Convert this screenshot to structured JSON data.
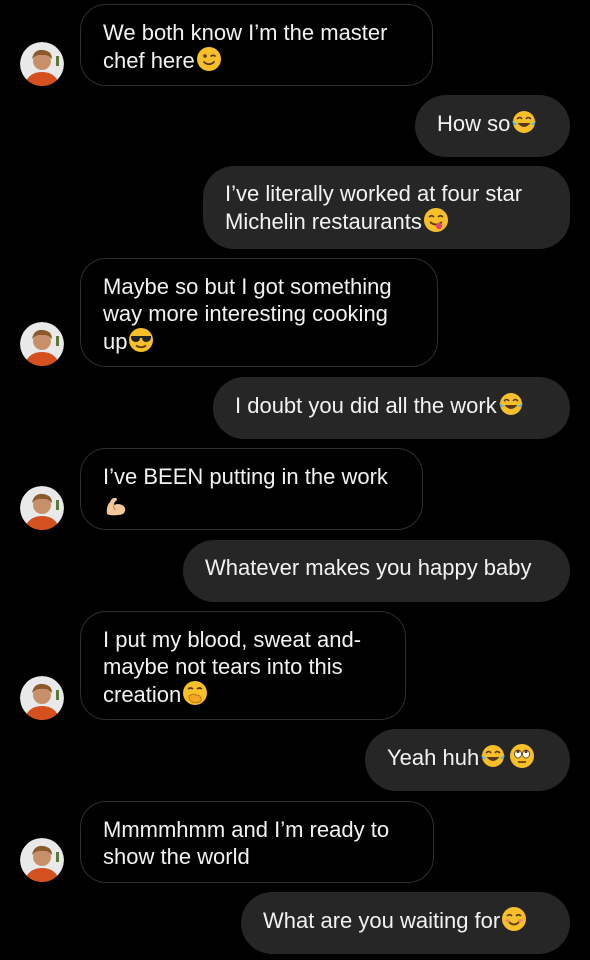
{
  "conversation": {
    "messages": [
      {
        "side": "in",
        "text": "We both know I’m the master chef here",
        "emoji": [
          "winking-face"
        ]
      },
      {
        "side": "out",
        "text": "How so",
        "emoji": [
          "tears-of-joy"
        ]
      },
      {
        "side": "out",
        "text": "I’ve literally worked at four star Michelin restaurants",
        "emoji": [
          "yum-face"
        ]
      },
      {
        "side": "in",
        "text": "Maybe so but I got something way more interesting cooking up",
        "emoji": [
          "sunglasses-face"
        ]
      },
      {
        "side": "out",
        "text": "I doubt you did all the work",
        "emoji": [
          "tears-of-joy"
        ]
      },
      {
        "side": "in",
        "text": "I’ve BEEN putting in the work",
        "emoji": [
          "flexed-biceps"
        ]
      },
      {
        "side": "out",
        "text": "Whatever makes you happy baby",
        "emoji": []
      },
      {
        "side": "in",
        "text": "I put my blood, sweat and- maybe not tears into this creation",
        "emoji": [
          "hand-over-mouth"
        ]
      },
      {
        "side": "out",
        "text": "Yeah huh",
        "emoji": [
          "tears-of-joy",
          "eye-roll"
        ]
      },
      {
        "side": "in",
        "text": "Mmmmhmm and I’m ready to show the world",
        "emoji": []
      },
      {
        "side": "out",
        "text": "What are you waiting for",
        "emoji": [
          "smiling-face"
        ]
      }
    ]
  },
  "colors": {
    "background": "#000000",
    "outgoing_bubble": "#262626",
    "incoming_border": "#2e2e2e",
    "text": "#f2f2f2",
    "emoji_yellow": "#f7c02b"
  }
}
